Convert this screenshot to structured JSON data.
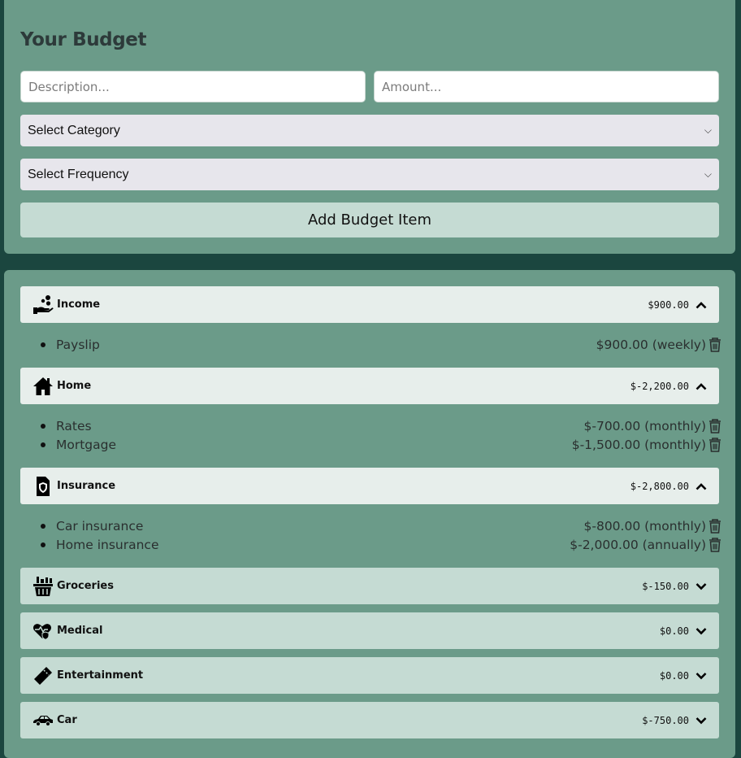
{
  "form": {
    "title": "Your Budget",
    "description_placeholder": "Description...",
    "amount_placeholder": "Amount...",
    "category_select": "Select Category",
    "frequency_select": "Select Frequency",
    "add_button": "Add Budget Item"
  },
  "categories": [
    {
      "name": "Income",
      "icon": "income-icon",
      "total": "$900.00",
      "expanded": true,
      "items": [
        {
          "label": "Payslip",
          "amount": "$900.00 (weekly)"
        }
      ]
    },
    {
      "name": "Home",
      "icon": "home-icon",
      "total": "$-2,200.00",
      "expanded": true,
      "items": [
        {
          "label": "Rates",
          "amount": "$-700.00 (monthly)"
        },
        {
          "label": "Mortgage",
          "amount": "$-1,500.00 (monthly)"
        }
      ]
    },
    {
      "name": "Insurance",
      "icon": "insurance-icon",
      "total": "$-2,800.00",
      "expanded": true,
      "items": [
        {
          "label": "Car insurance",
          "amount": "$-800.00 (monthly)"
        },
        {
          "label": "Home insurance",
          "amount": "$-2,000.00 (annually)"
        }
      ]
    },
    {
      "name": "Groceries",
      "icon": "groceries-icon",
      "total": "$-150.00",
      "expanded": false,
      "items": []
    },
    {
      "name": "Medical",
      "icon": "medical-icon",
      "total": "$0.00",
      "expanded": false,
      "items": []
    },
    {
      "name": "Entertainment",
      "icon": "ticket-icon",
      "total": "$0.00",
      "expanded": false,
      "items": []
    },
    {
      "name": "Car",
      "icon": "car-icon",
      "total": "$-750.00",
      "expanded": false,
      "items": []
    }
  ],
  "colors": {
    "background": "#1b463f",
    "panel": "#6b9b89",
    "header_open": "#e7eeeb",
    "header_closed": "#c5dbd3"
  }
}
